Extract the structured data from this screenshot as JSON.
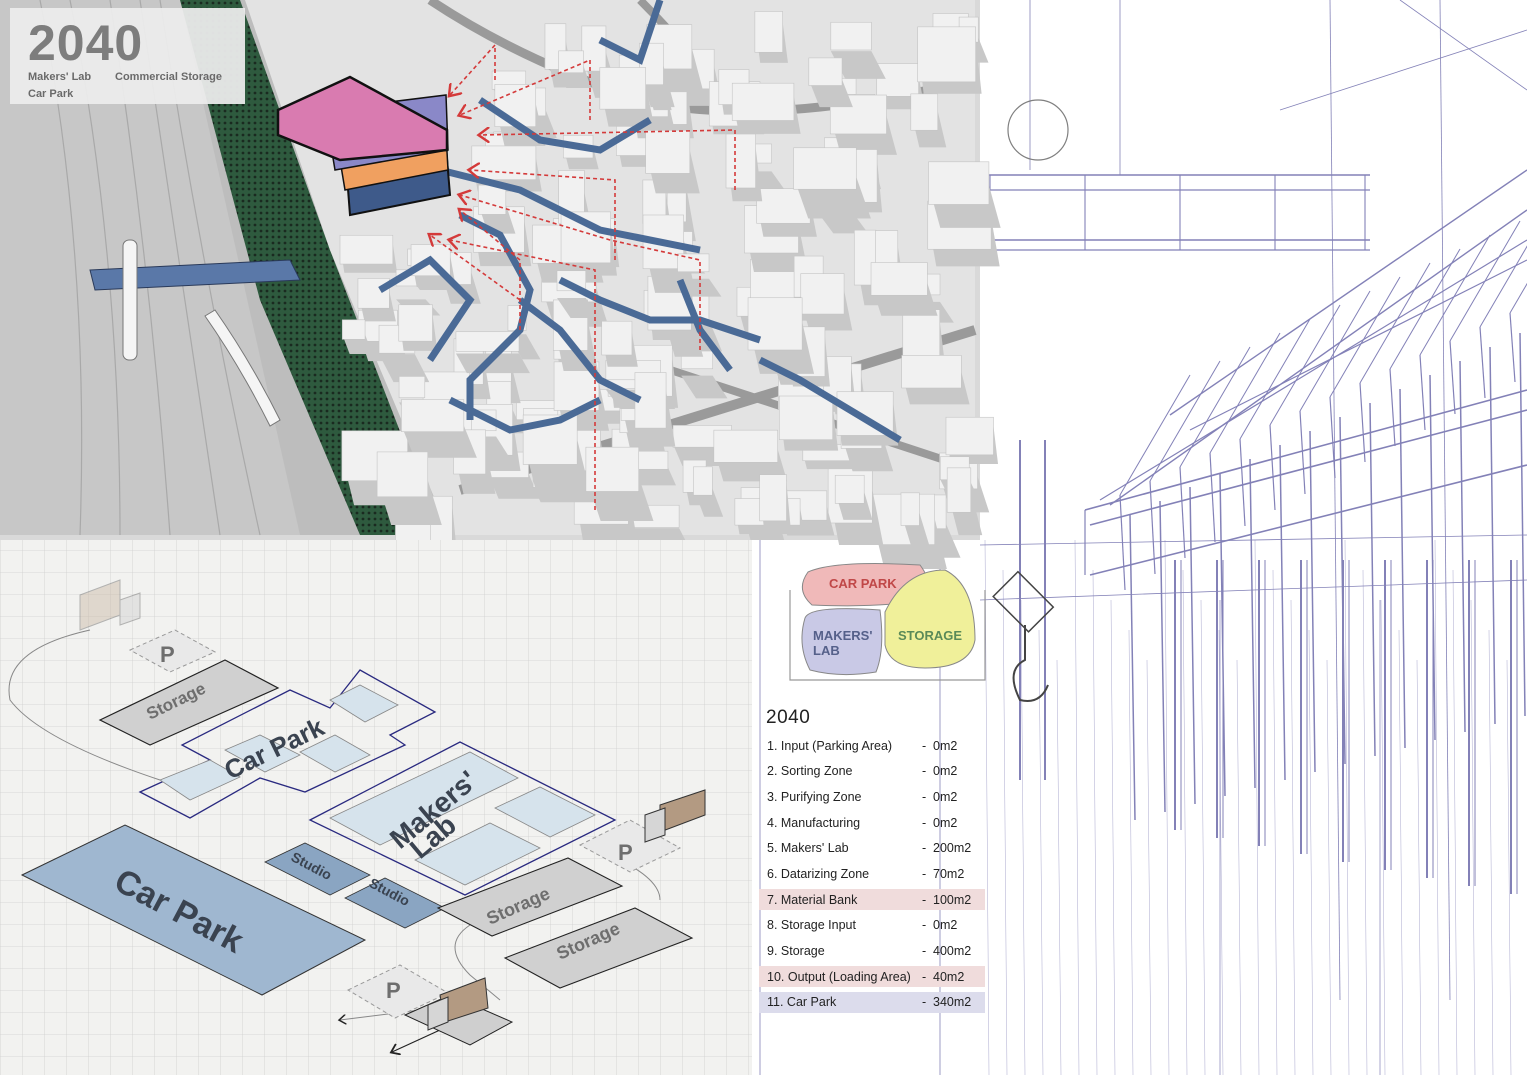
{
  "site_plan": {
    "year": "2040",
    "legend": [
      "Makers' Lab",
      "Commercial Storage",
      "Car Park"
    ]
  },
  "iso_diagram": {
    "labels": {
      "storage_top": "Storage",
      "car_park_upper": "Car Park",
      "makers_lab_line1": "Makers'",
      "makers_lab_line2": "Lab",
      "car_park_lower": "Car Park",
      "studio_1": "Studio",
      "studio_2": "Studio",
      "storage_mid": "Storage",
      "storage_low": "Storage",
      "parking_glyph": "P"
    }
  },
  "bubbles": {
    "car_park": "CAR PARK",
    "makers_lab_line1": "MAKERS'",
    "makers_lab_line2": "LAB",
    "storage": "STORAGE"
  },
  "program": {
    "title": "2040",
    "rows": [
      {
        "name": "1. Input (Parking Area)",
        "area": "0m2",
        "highlight": "none"
      },
      {
        "name": "2. Sorting Zone",
        "area": "0m2",
        "highlight": "none"
      },
      {
        "name": "3. Purifying Zone",
        "area": "0m2",
        "highlight": "none"
      },
      {
        "name": "4. Manufacturing",
        "area": "0m2",
        "highlight": "none"
      },
      {
        "name": "5. Makers' Lab",
        "area": "200m2",
        "highlight": "none"
      },
      {
        "name": "6. Datarizing Zone",
        "area": "70m2",
        "highlight": "none"
      },
      {
        "name": "7. Material Bank",
        "area": "100m2",
        "highlight": "red"
      },
      {
        "name": "8. Storage Input",
        "area": "0m2",
        "highlight": "none"
      },
      {
        "name": "9. Storage",
        "area": "400m2",
        "highlight": "none"
      },
      {
        "name": "10. Output (Loading Area)",
        "area": "40m2",
        "highlight": "red"
      },
      {
        "name": "11. Car Park",
        "area": "340m2",
        "highlight": "blue"
      }
    ],
    "dash": "-"
  },
  "colors": {
    "makers_lab": "#d97bb0",
    "commercial_storage": "#f0a060",
    "car_park": "#8a88c8",
    "alley_blue": "#4a6a96",
    "route_red": "#d43a3a",
    "green_buffer": "#2f6b4a",
    "iso_blue": "#9fb7d0",
    "bubble_red": "#f0b9b9",
    "bubble_purple": "#c9c9e6",
    "bubble_yellow": "#f0f09a",
    "wire": "#5a58a0"
  }
}
